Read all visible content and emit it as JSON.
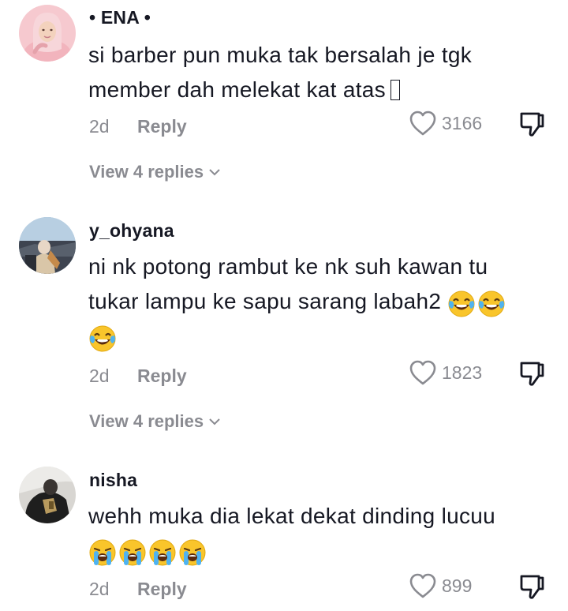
{
  "comments": [
    {
      "username": "• ENA •",
      "text_lines": [
        "si barber pun muka tak bersalah je tgk",
        "member dah melekat kat atas"
      ],
      "time": "2d",
      "reply_label": "Reply",
      "likes": "3166",
      "view_replies": "View 4 replies",
      "avatar_icon": "avatar-woman-hijab"
    },
    {
      "username": "y_ohyana",
      "text_lines": [
        "ni nk potong rambut ke nk suh kawan tu",
        "tukar lampu ke sapu sarang labah2"
      ],
      "emoji": [
        "face-with-tears-of-joy-icon",
        "face-with-tears-of-joy-icon",
        "face-with-tears-of-joy-icon"
      ],
      "time": "2d",
      "reply_label": "Reply",
      "likes": "1823",
      "view_replies": "View 4 replies",
      "avatar_icon": "avatar-outdoor-photo"
    },
    {
      "username": "nisha",
      "text_lines": [
        "wehh muka dia lekat dekat dinding lucuu"
      ],
      "emoji": [
        "loudly-crying-face-icon",
        "loudly-crying-face-icon",
        "loudly-crying-face-icon",
        "loudly-crying-face-icon"
      ],
      "time": "2d",
      "reply_label": "Reply",
      "likes": "899",
      "avatar_icon": "avatar-dark-photo"
    }
  ],
  "colors": {
    "primary_text": "#161823",
    "secondary_text": "#8a8b91",
    "background": "#ffffff"
  }
}
